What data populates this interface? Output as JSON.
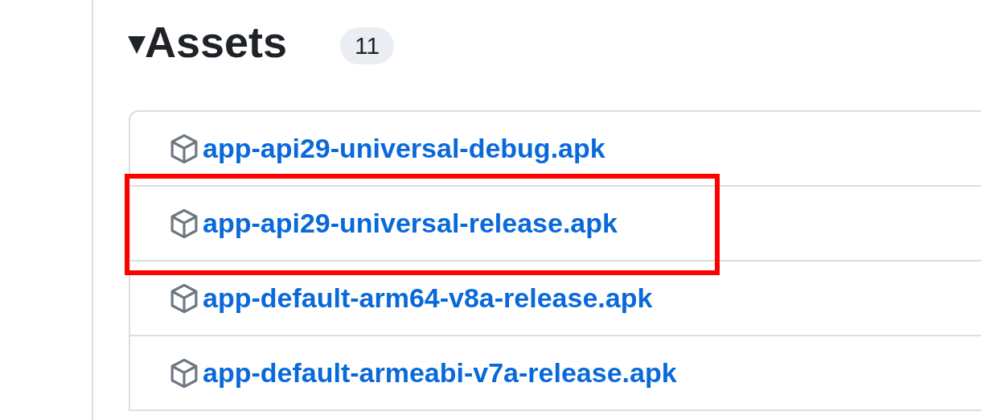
{
  "assets": {
    "expanded": true,
    "toggle": "▾",
    "title": "Assets",
    "count": "11",
    "items": [
      {
        "name": "app-api29-universal-debug.apk",
        "highlighted": false
      },
      {
        "name": "app-api29-universal-release.apk",
        "highlighted": true
      },
      {
        "name": "app-default-arm64-v8a-release.apk",
        "highlighted": false
      },
      {
        "name": "app-default-armeabi-v7a-release.apk",
        "highlighted": false
      }
    ]
  }
}
